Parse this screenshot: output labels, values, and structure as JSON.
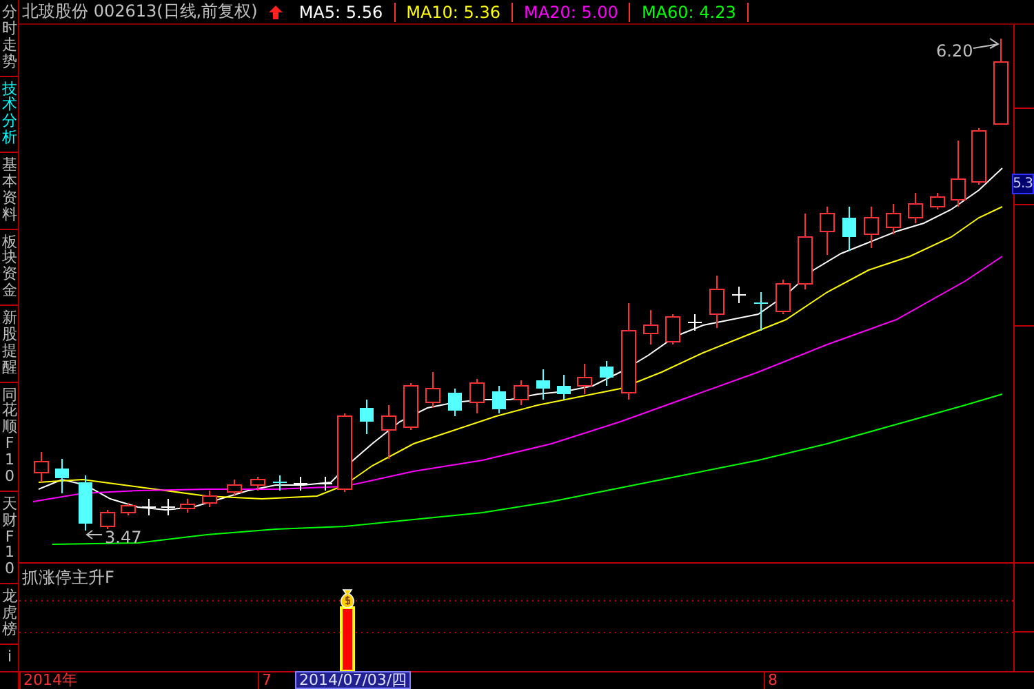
{
  "header": {
    "title": "北玻股份 002613(日线,前复权)",
    "indicators": [
      {
        "label": "MA5: 5.56",
        "color": "#ffffff"
      },
      {
        "label": "MA10: 5.36",
        "color": "#ffff00"
      },
      {
        "label": "MA20: 5.00",
        "color": "#ff00ff"
      },
      {
        "label": "MA60: 4.23",
        "color": "#00ff00"
      }
    ]
  },
  "side_tabs": [
    {
      "label": "分时走势",
      "selected": false
    },
    {
      "label": "技术分析",
      "selected": true
    },
    {
      "label": "基本资料",
      "selected": false
    },
    {
      "label": "板块资金",
      "selected": false
    },
    {
      "label": "新股提醒",
      "selected": false
    },
    {
      "label": "同花顺F10",
      "selected": false
    },
    {
      "label": "天财F10",
      "selected": false
    },
    {
      "label": "龙虎榜",
      "selected": false
    },
    {
      "label": "i",
      "selected": false
    }
  ],
  "price_chart": {
    "high_label": "6.20",
    "low_label": "3.47",
    "current_price": "5.3"
  },
  "indicator_panel": {
    "title": "抓涨停主升F"
  },
  "time_axis": {
    "labels": [
      {
        "text": "2014年",
        "selected": false
      },
      {
        "text": "7",
        "selected": false
      },
      {
        "text": "2014/07/03/四",
        "selected": true
      },
      {
        "text": "8",
        "selected": false
      }
    ]
  }
}
